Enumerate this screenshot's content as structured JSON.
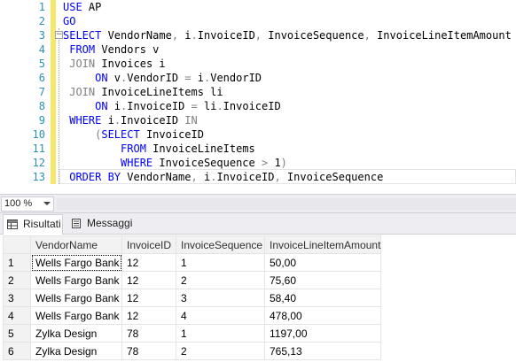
{
  "editor": {
    "lines": [
      {
        "n": "1",
        "tokens": [
          [
            "kw",
            "USE"
          ],
          [
            "tx",
            " AP"
          ]
        ]
      },
      {
        "n": "2",
        "tokens": [
          [
            "kw",
            "GO"
          ]
        ]
      },
      {
        "n": "3",
        "tokens": [
          [
            "kw",
            "SELECT"
          ],
          [
            "tx",
            " VendorName"
          ],
          [
            "gr",
            ","
          ],
          [
            "tx",
            " i"
          ],
          [
            "gr",
            "."
          ],
          [
            "tx",
            "InvoiceID"
          ],
          [
            "gr",
            ","
          ],
          [
            "tx",
            " InvoiceSequence"
          ],
          [
            "gr",
            ","
          ],
          [
            "tx",
            " InvoiceLineItemAmount"
          ]
        ]
      },
      {
        "n": "4",
        "tokens": [
          [
            "tx",
            " "
          ],
          [
            "kw",
            "FROM"
          ],
          [
            "tx",
            " Vendors v"
          ]
        ]
      },
      {
        "n": "5",
        "tokens": [
          [
            "tx",
            " "
          ],
          [
            "gr",
            "JOIN"
          ],
          [
            "tx",
            " Invoices i"
          ]
        ]
      },
      {
        "n": "6",
        "tokens": [
          [
            "tx",
            "     "
          ],
          [
            "kw",
            "ON"
          ],
          [
            "tx",
            " v"
          ],
          [
            "gr",
            "."
          ],
          [
            "tx",
            "VendorID "
          ],
          [
            "gr",
            "="
          ],
          [
            "tx",
            " i"
          ],
          [
            "gr",
            "."
          ],
          [
            "tx",
            "VendorID"
          ]
        ]
      },
      {
        "n": "7",
        "tokens": [
          [
            "tx",
            " "
          ],
          [
            "gr",
            "JOIN"
          ],
          [
            "tx",
            " InvoiceLineItems li"
          ]
        ]
      },
      {
        "n": "8",
        "tokens": [
          [
            "tx",
            "     "
          ],
          [
            "kw",
            "ON"
          ],
          [
            "tx",
            " i"
          ],
          [
            "gr",
            "."
          ],
          [
            "tx",
            "InvoiceID "
          ],
          [
            "gr",
            "="
          ],
          [
            "tx",
            " li"
          ],
          [
            "gr",
            "."
          ],
          [
            "tx",
            "InvoiceID"
          ]
        ]
      },
      {
        "n": "9",
        "tokens": [
          [
            "tx",
            " "
          ],
          [
            "kw",
            "WHERE"
          ],
          [
            "tx",
            " i"
          ],
          [
            "gr",
            "."
          ],
          [
            "tx",
            "InvoiceID "
          ],
          [
            "gr",
            "IN"
          ]
        ]
      },
      {
        "n": "10",
        "tokens": [
          [
            "tx",
            "     "
          ],
          [
            "gr",
            "("
          ],
          [
            "kw",
            "SELECT"
          ],
          [
            "tx",
            " InvoiceID"
          ]
        ]
      },
      {
        "n": "11",
        "tokens": [
          [
            "tx",
            "         "
          ],
          [
            "kw",
            "FROM"
          ],
          [
            "tx",
            " InvoiceLineItems"
          ]
        ]
      },
      {
        "n": "12",
        "tokens": [
          [
            "tx",
            "         "
          ],
          [
            "kw",
            "WHERE"
          ],
          [
            "tx",
            " InvoiceSequence "
          ],
          [
            "gr",
            ">"
          ],
          [
            "tx",
            " 1"
          ],
          [
            "gr",
            ")"
          ]
        ]
      },
      {
        "n": "13",
        "tokens": [
          [
            "tx",
            " "
          ],
          [
            "kw",
            "ORDER BY"
          ],
          [
            "tx",
            " VendorName"
          ],
          [
            "gr",
            ","
          ],
          [
            "tx",
            " i"
          ],
          [
            "gr",
            "."
          ],
          [
            "tx",
            "InvoiceID"
          ],
          [
            "gr",
            ","
          ],
          [
            "tx",
            " InvoiceSequence"
          ]
        ]
      }
    ]
  },
  "zoom": {
    "value": "100 %"
  },
  "tabs": {
    "results_label": "Risultati",
    "messages_label": "Messaggi"
  },
  "grid": {
    "columns": [
      "VendorName",
      "InvoiceID",
      "InvoiceSequence",
      "InvoiceLineItemAmount"
    ],
    "rows": [
      {
        "n": "1",
        "cells": [
          "Wells Fargo Bank",
          "12",
          "1",
          "50,00"
        ]
      },
      {
        "n": "2",
        "cells": [
          "Wells Fargo Bank",
          "12",
          "2",
          "75,60"
        ]
      },
      {
        "n": "3",
        "cells": [
          "Wells Fargo Bank",
          "12",
          "3",
          "58,40"
        ]
      },
      {
        "n": "4",
        "cells": [
          "Wells Fargo Bank",
          "12",
          "4",
          "478,00"
        ]
      },
      {
        "n": "5",
        "cells": [
          "Zylka Design",
          "78",
          "1",
          "1197,00"
        ]
      },
      {
        "n": "6",
        "cells": [
          "Zylka Design",
          "78",
          "2",
          "765,13"
        ]
      }
    ]
  },
  "icons": {
    "results": "grid-icon",
    "messages": "message-icon",
    "collapse": "collapse-minus-icon"
  }
}
